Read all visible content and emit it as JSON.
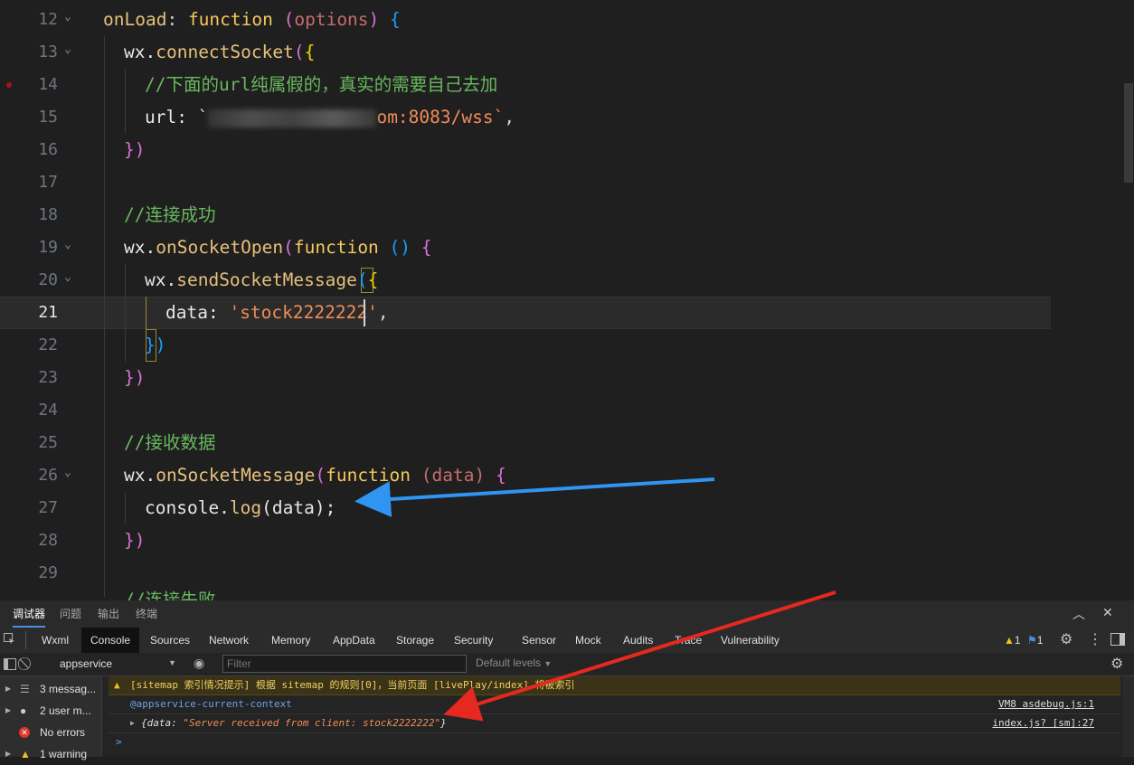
{
  "editor": {
    "line_numbers": [
      "12",
      "13",
      "14",
      "15",
      "16",
      "17",
      "18",
      "19",
      "20",
      "21",
      "22",
      "23",
      "24",
      "25",
      "26",
      "27",
      "28",
      "29"
    ],
    "active_line": "21",
    "code": {
      "l12_name": "onLoad",
      "l12_colon": ": ",
      "l12_kw": "function",
      "l12_space": " ",
      "l12_open": "(",
      "l12_param": "options",
      "l12_close": ")",
      "l12_brace": " {",
      "l13_obj": "wx.",
      "l13_fn": "connectSocket",
      "l13_open": "(",
      "l13_brace": "{",
      "l14_comment": "//下面的url纯属假的，真实的需要自己去加",
      "l15_key": "url: `",
      "l15_tail": "om:8083/wss`",
      "l15_comma": ",",
      "l16_close": "})",
      "l18_comment": "//连接成功",
      "l19_obj": "wx.",
      "l19_fn": "onSocketOpen",
      "l19_open": "(",
      "l19_kw": "function",
      "l19_parens": " ()",
      "l19_brace": " {",
      "l20_obj": "wx.",
      "l20_fn": "sendSocketMessage",
      "l20_open": "(",
      "l20_brace": "{",
      "l21_key": "data: ",
      "l21_str": "'stock2222222'",
      "l21_comma": ",",
      "l22_close": "})",
      "l23_close": "})",
      "l25_comment": "//接收数据",
      "l26_obj": "wx.",
      "l26_fn": "onSocketMessage",
      "l26_open": "(",
      "l26_kw": "function",
      "l26_param": " (data)",
      "l26_brace": " {",
      "l27_code": "console.",
      "l27_fn": "log",
      "l27_args": "(data);",
      "l28_close": "})",
      "l30_partial": "//连接失败"
    }
  },
  "panel_tabs": [
    "调试器",
    "问题",
    "输出",
    "终端"
  ],
  "devtools_tabs": [
    "Wxml",
    "Console",
    "Sources",
    "Network",
    "Memory",
    "AppData",
    "Storage",
    "Security",
    "Sensor",
    "Mock",
    "Audits",
    "Trace",
    "Vulnerability"
  ],
  "badges": {
    "warn_count": "1",
    "info_count": "1"
  },
  "filter": {
    "context": "appservice",
    "placeholder": "Filter",
    "levels": "Default levels"
  },
  "sidebar": {
    "messages": "3 messag...",
    "user": "2 user m...",
    "errors": "No errors",
    "warnings": "1 warning"
  },
  "console": {
    "warning_text": "[sitemap 索引情况提示] 根据 sitemap 的规则[0]，当前页面 [livePlay/index] 将被索引",
    "context_label": "@appservice-current-context",
    "context_src": "VM8 asdebug.js:1",
    "log_key": "{data: ",
    "log_value": "\"Server received from client: stock2222222\"",
    "log_end": "}",
    "log_src": "index.js? [sm]:27",
    "prompt": ">"
  },
  "colors": {
    "arrow_blue": "#2f95f0",
    "arrow_red": "#e5291f",
    "active_tab_bg": "#111111"
  }
}
